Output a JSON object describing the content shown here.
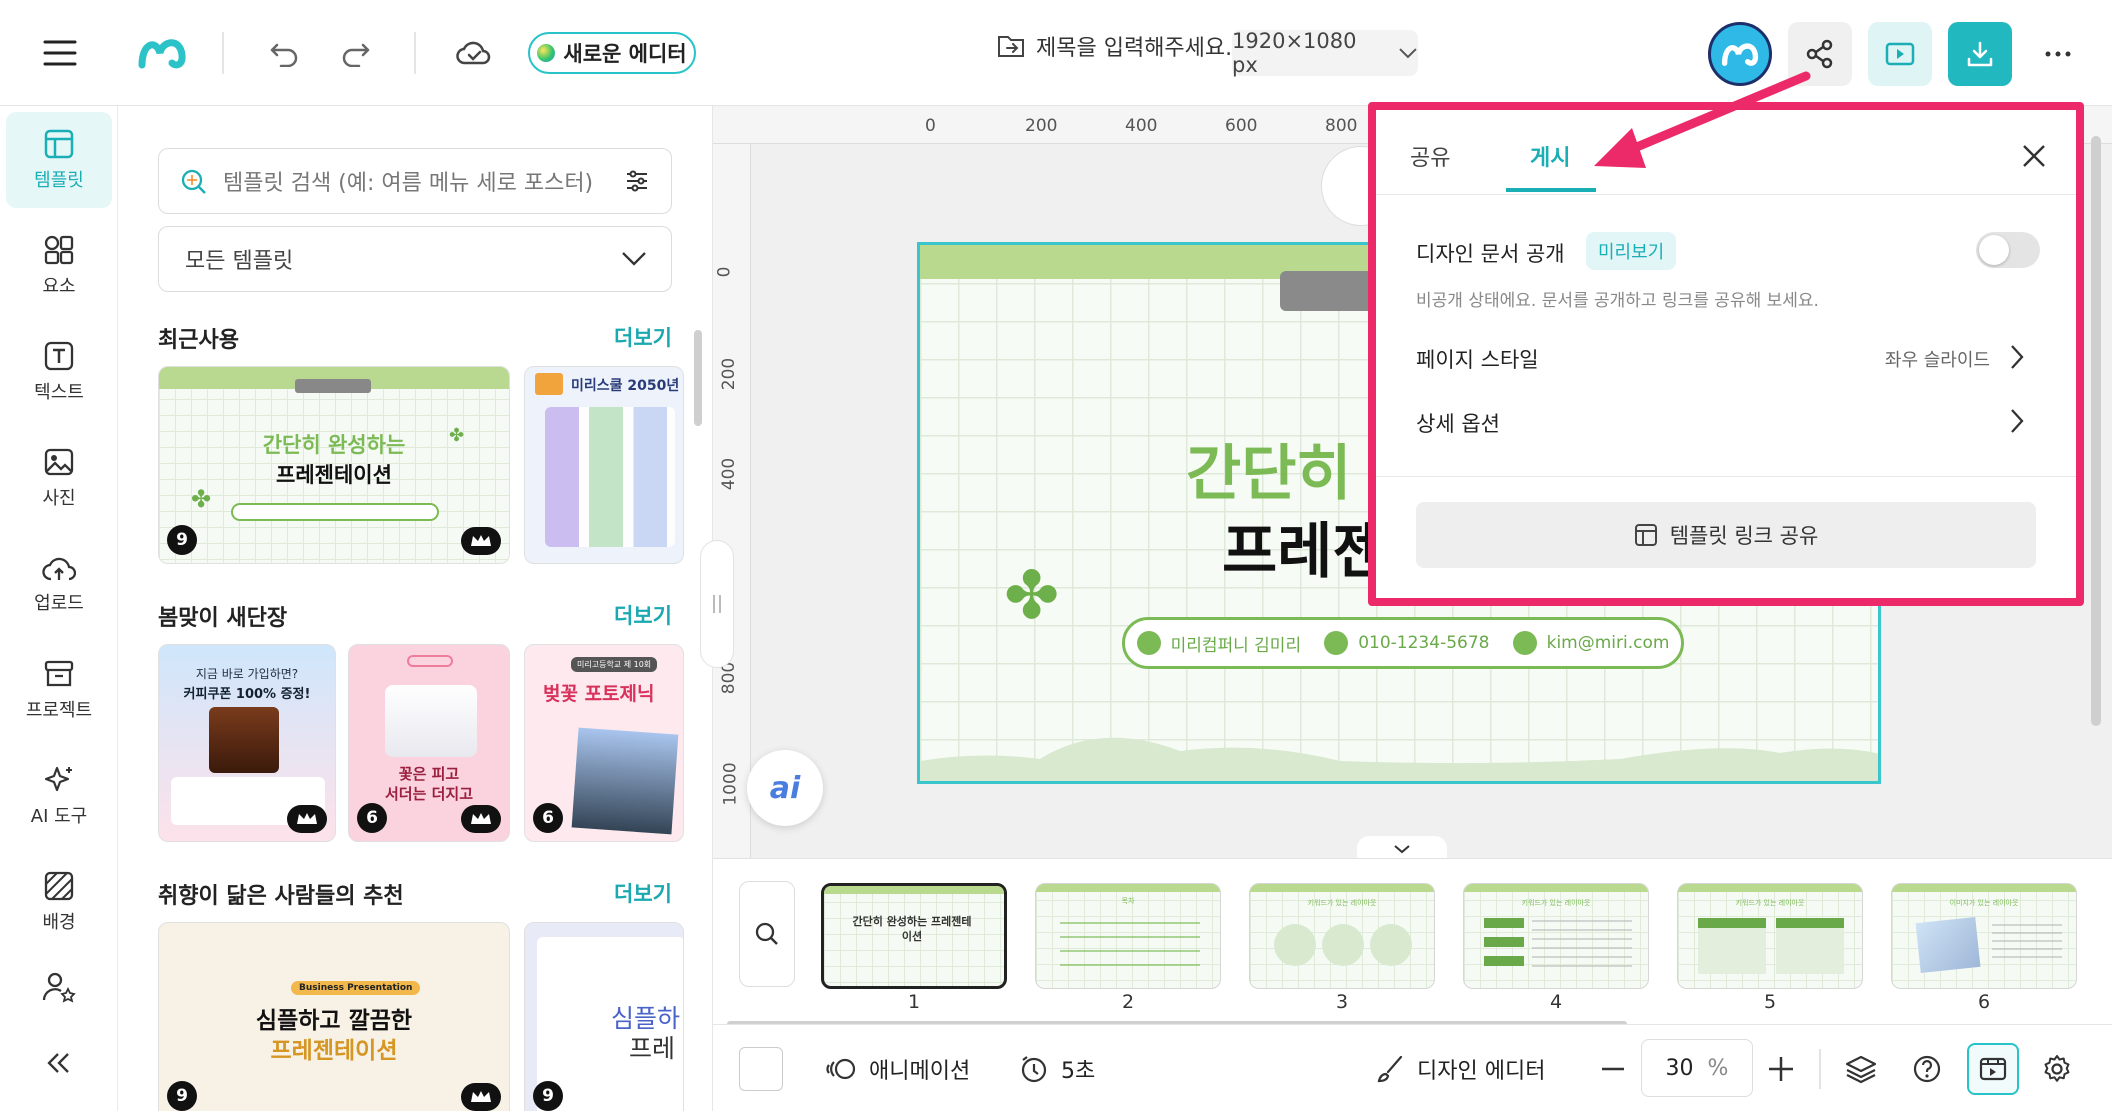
{
  "topbar": {
    "new_editor": "새로운 에디터",
    "doc_title": "제목을 입력해주세요.",
    "canvas_size": "1920×1080 px"
  },
  "rail": {
    "items": [
      {
        "label": "템플릿",
        "icon": "template-icon"
      },
      {
        "label": "요소",
        "icon": "elements-icon"
      },
      {
        "label": "텍스트",
        "icon": "text-icon"
      },
      {
        "label": "사진",
        "icon": "photo-icon"
      },
      {
        "label": "업로드",
        "icon": "upload-icon"
      },
      {
        "label": "프로젝트",
        "icon": "project-icon"
      },
      {
        "label": "AI 도구",
        "icon": "ai-tools-icon"
      },
      {
        "label": "배경",
        "icon": "background-icon"
      }
    ]
  },
  "panel": {
    "search_placeholder": "템플릿 검색 (예: 여름 메뉴 세로 포스터)",
    "select_value": "모든 템플릿",
    "sections": [
      {
        "title": "최근사용",
        "more": "더보기"
      },
      {
        "title": "봄맞이 새단장",
        "more": "더보기"
      },
      {
        "title": "취향이 닮은 사람들의 추천",
        "more": "더보기"
      }
    ],
    "recent": {
      "card1_line1": "간단히 완성하는",
      "card1_line2": "프레젠테이션",
      "card1_count": "9",
      "card2_title": "미리스쿨 2050년"
    },
    "spring": {
      "card1_line1": "지금 바로 가입하면?",
      "card1_line2": "커피쿠폰 100% 증정!",
      "card2_line1": "꽃은 피고",
      "card2_line2": "서더는 더지고",
      "card2_count": "6",
      "card3_tag": "미리고등학교 제 10회",
      "card3_title": "벚꽃 포토제닉 ",
      "card3_count": "6"
    },
    "recommend": {
      "card1_tag": "Business Presentation",
      "card1_line1": "심플하고 깔끔한",
      "card1_line2": "프레젠테이션",
      "card1_count": "9",
      "card2_line1": "심플하",
      "card2_line2": "프레",
      "card2_count": "9"
    }
  },
  "rulers": {
    "h": [
      "0",
      "200",
      "400",
      "600",
      "800"
    ],
    "v": [
      "0",
      "200",
      "400",
      "600",
      "800",
      "1000"
    ]
  },
  "slide": {
    "line1": "간단히",
    "line2": "프레젠",
    "name": "미리컴퍼니 김미리",
    "phone": "010-1234-5678",
    "email": "kim@miri.com"
  },
  "popup": {
    "tab_share": "공유",
    "tab_publish": "게시",
    "publish_label": "디자인 문서 공개",
    "preview_badge": "미리보기",
    "publish_desc": "비공개 상태에요. 문서를 공개하고 링크를 공유해 보세요.",
    "page_style_label": "페이지 스타일",
    "page_style_value": "좌우 슬라이드",
    "detail_options": "상세 옵션",
    "template_link_btn": "템플릿 링크 공유",
    "publish_enabled": false
  },
  "filmstrip": {
    "pages": [
      {
        "num": "1",
        "title": "간단히 완성하는 프레젠테이션"
      },
      {
        "num": "2",
        "title": "목차"
      },
      {
        "num": "3",
        "title": "키워드가 있는 레이아웃"
      },
      {
        "num": "4",
        "title": "키워드가 있는 레이아웃"
      },
      {
        "num": "5",
        "title": "키워드가 있는 레이아웃"
      },
      {
        "num": "6",
        "title": "이미지가 있는 레이아웃"
      }
    ]
  },
  "bottombar": {
    "animation": "애니메이션",
    "duration": "5초",
    "design_editor": "디자인 에디터",
    "zoom": "30",
    "zoom_unit": "%"
  },
  "colors": {
    "accent": "#1aaeb5",
    "highlight": "#ec2a6a",
    "slide_green": "#7cba55"
  }
}
